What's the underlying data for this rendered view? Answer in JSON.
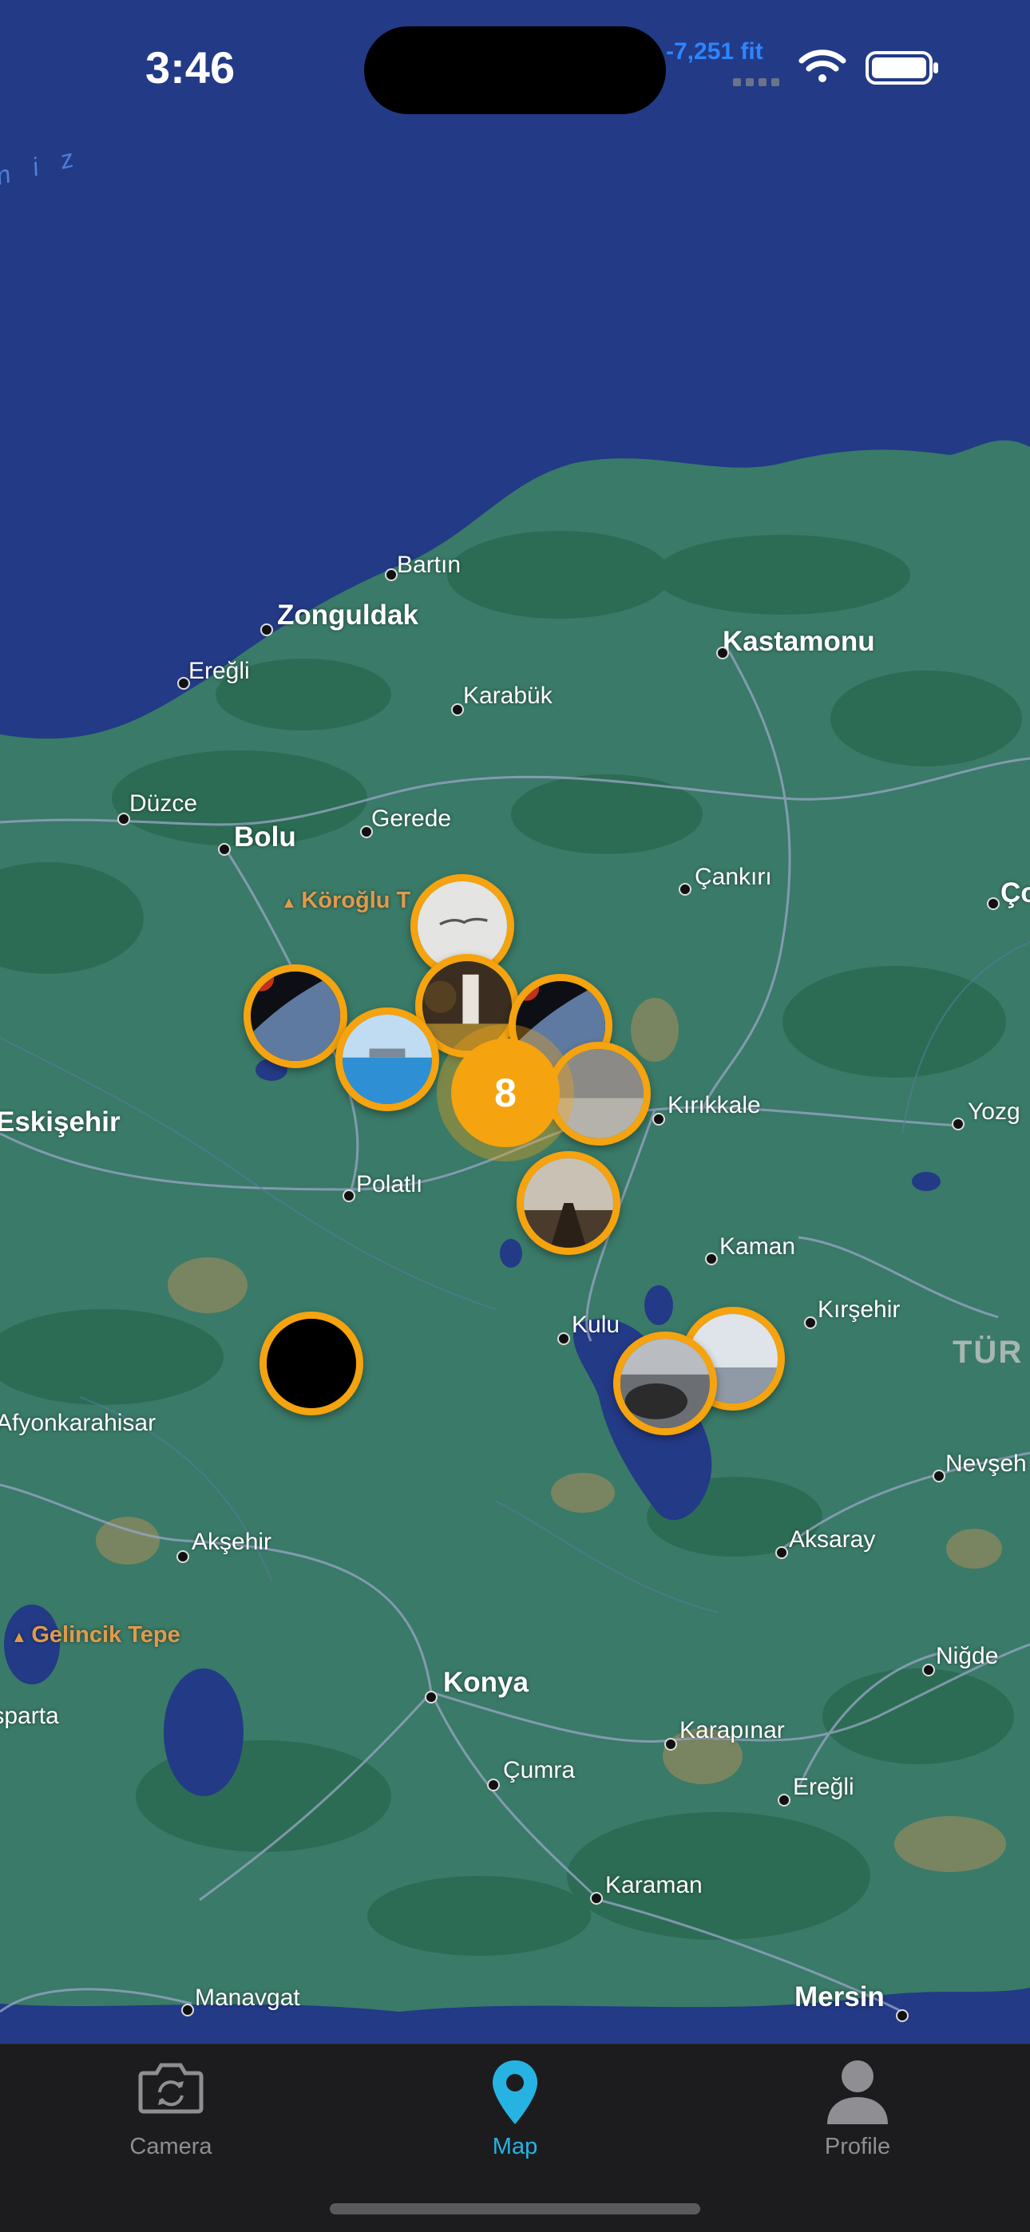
{
  "status_bar": {
    "time": "3:46",
    "altitude": "-7,251 fit"
  },
  "map": {
    "sea_label": "n i z",
    "cities": [
      {
        "name": "Bartın"
      },
      {
        "name": "Zonguldak"
      },
      {
        "name": "Kastamonu"
      },
      {
        "name": "Ereğli"
      },
      {
        "name": "Karabük"
      },
      {
        "name": "Düzce"
      },
      {
        "name": "Bolu"
      },
      {
        "name": "Gerede"
      },
      {
        "name": "Çankırı"
      },
      {
        "name": "Ço"
      },
      {
        "name": "Eskişehir"
      },
      {
        "name": "Kırıkkale"
      },
      {
        "name": "Yozg"
      },
      {
        "name": "Polatlı"
      },
      {
        "name": "Kaman"
      },
      {
        "name": "Kırşehir"
      },
      {
        "name": "Kulu"
      },
      {
        "name": "Afyonkarahisar"
      },
      {
        "name": "Nevşeh"
      },
      {
        "name": "Akşehir"
      },
      {
        "name": "Aksaray"
      },
      {
        "name": "Niğde"
      },
      {
        "name": "Konya"
      },
      {
        "name": "Isparta"
      },
      {
        "name": "Karapınar"
      },
      {
        "name": "Çumra"
      },
      {
        "name": "Ereğli"
      },
      {
        "name": "Karaman"
      },
      {
        "name": "Manavgat"
      },
      {
        "name": "Mersin"
      }
    ],
    "peaks": [
      {
        "name": "Köroğlu T"
      },
      {
        "name": "Gelincik Tepe"
      }
    ],
    "region_label": "TÜR",
    "cluster_count": "8",
    "accent_color": "#f5a30f"
  },
  "tabs": [
    {
      "label": "Camera",
      "icon": "camera-rotate-icon",
      "active": false
    },
    {
      "label": "Map",
      "icon": "map-pin-icon",
      "active": true
    },
    {
      "label": "Profile",
      "icon": "person-icon",
      "active": false
    }
  ],
  "colors": {
    "sea": "#233a86",
    "land": "#3a7a68",
    "tab_active": "#27b3e2",
    "tab_inactive": "#8e8e93"
  }
}
